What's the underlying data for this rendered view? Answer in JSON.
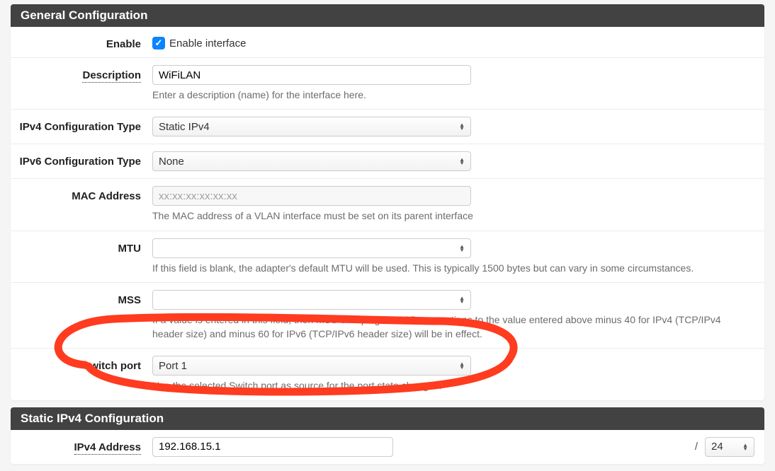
{
  "panel1": {
    "title": "General Configuration",
    "enable": {
      "label": "Enable",
      "checked": true,
      "text": "Enable interface"
    },
    "description": {
      "label": "Description",
      "value": "WiFiLAN",
      "help": "Enter a description (name) for the interface here."
    },
    "ipv4type": {
      "label": "IPv4 Configuration Type",
      "value": "Static IPv4"
    },
    "ipv6type": {
      "label": "IPv6 Configuration Type",
      "value": "None"
    },
    "mac": {
      "label": "MAC Address",
      "placeholder": "xx:xx:xx:xx:xx:xx",
      "help": "The MAC address of a VLAN interface must be set on its parent interface"
    },
    "mtu": {
      "label": "MTU",
      "help": "If this field is blank, the adapter's default MTU will be used. This is typically 1500 bytes but can vary in some circumstances."
    },
    "mss": {
      "label": "MSS",
      "help": "If a value is entered in this field, then MSS clamping for TCP connections to the value entered above minus 40 for IPv4 (TCP/IPv4 header size) and minus 60 for IPv6 (TCP/IPv6 header size) will be in effect."
    },
    "switchport": {
      "label": "Switch port",
      "value": "Port 1",
      "help": "Use the selected Switch port as source for the port state changes."
    }
  },
  "panel2": {
    "title": "Static IPv4 Configuration",
    "ipv4addr": {
      "label": "IPv4 Address",
      "value": "192.168.15.1",
      "slash": "/",
      "mask": "24"
    }
  }
}
